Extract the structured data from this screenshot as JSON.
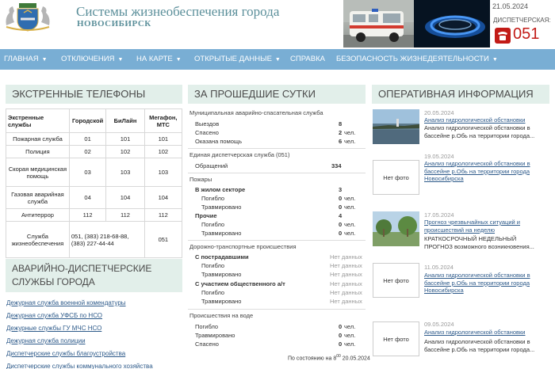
{
  "header": {
    "title": "Системы жизнеобеспечения города",
    "subtitle": "НОВОСИБИРСК",
    "date": "21.05.2024",
    "dispatch_label": "ДИСПЕТЧЕРСКАЯ:",
    "dispatch_number": "051"
  },
  "nav": {
    "items": [
      {
        "label": "ГЛАВНАЯ",
        "dropdown": true
      },
      {
        "label": "ОТКЛЮЧЕНИЯ",
        "dropdown": true
      },
      {
        "label": "НА КАРТЕ",
        "dropdown": true
      },
      {
        "label": "ОТКРЫТЫЕ ДАННЫЕ",
        "dropdown": true
      },
      {
        "label": "СПРАВКА",
        "dropdown": false
      },
      {
        "label": "БЕЗОПАСНОСТЬ ЖИЗНЕДЕЯТЕЛЬНОСТИ",
        "dropdown": true
      }
    ]
  },
  "phones": {
    "heading": "ЭКСТРЕННЫЕ ТЕЛЕФОНЫ",
    "columns": [
      "Экстренные службы",
      "Городской",
      "БиЛайн",
      "Мегафон, МТС"
    ],
    "rows": [
      {
        "service": "Пожарная служба",
        "city": "01",
        "beeline": "101",
        "megafon": "101"
      },
      {
        "service": "Полиция",
        "city": "02",
        "beeline": "102",
        "megafon": "102"
      },
      {
        "service": "Скорая медицинская помощь",
        "city": "03",
        "beeline": "103",
        "megafon": "103"
      },
      {
        "service": "Газовая аварийная служба",
        "city": "04",
        "beeline": "104",
        "megafon": "104"
      },
      {
        "service": "Антитеррор",
        "city": "112",
        "beeline": "112",
        "megafon": "112"
      },
      {
        "service": "Служба жизнеобеспечения",
        "city": "051, (383) 218-68-88, (383) 227-44-44",
        "beeline": "",
        "megafon": "051"
      }
    ]
  },
  "emergency_services": {
    "heading": "АВАРИЙНО-ДИСПЕТЧЕРСКИЕ СЛУЖБЫ ГОРОДА",
    "links": [
      "Дежурная служба военной комендатуры",
      "Дежурная служба УФСБ по НСО",
      "Дежурные службы ГУ МЧС НСО",
      "Дежурная служба полиции",
      "Диспетчерские службы благоустройства",
      "Диспетчерские службы коммунального хозяйства"
    ]
  },
  "day": {
    "heading": "ЗА ПРОШЕДШИЕ СУТКИ",
    "rescue": {
      "title": "Муниципальная аварийно-спасательная служба",
      "rows": [
        {
          "label": "Выездов",
          "value": "8",
          "unit": ""
        },
        {
          "label": "Спасено",
          "value": "2",
          "unit": "чел."
        },
        {
          "label": "Оказана помощь",
          "value": "6",
          "unit": "чел."
        }
      ]
    },
    "dispatch": {
      "title": "Единая диспетчерская служба (051)",
      "label": "Обращений",
      "value": "334"
    },
    "fires": {
      "title": "Пожары",
      "rows": [
        {
          "label": "В жилом секторе",
          "value": "3",
          "unit": "",
          "bold": true
        },
        {
          "label": "Погибло",
          "value": "0",
          "unit": "чел."
        },
        {
          "label": "Травмировано",
          "value": "0",
          "unit": "чел."
        },
        {
          "label": "Прочие",
          "value": "4",
          "unit": "",
          "bold": true
        },
        {
          "label": "Погибло",
          "value": "0",
          "unit": "чел."
        },
        {
          "label": "Травмировано",
          "value": "0",
          "unit": "чел."
        }
      ]
    },
    "road": {
      "title": "Дорожно-транспортные происшествия",
      "rows": [
        {
          "label": "С пострадавшими",
          "value": "Нет данных",
          "bold": true
        },
        {
          "label": "Погибло",
          "value": "Нет данных"
        },
        {
          "label": "Травмировано",
          "value": "Нет данных"
        },
        {
          "label": "С участием общественного а/т",
          "value": "Нет данных",
          "bold": true
        },
        {
          "label": "Погибло",
          "value": "Нет данных"
        },
        {
          "label": "Травмировано",
          "value": "Нет данных"
        }
      ]
    },
    "water": {
      "title": "Происшествия на воде",
      "rows": [
        {
          "label": "Погибло",
          "value": "0",
          "unit": "чел."
        },
        {
          "label": "Травмировано",
          "value": "0",
          "unit": "чел."
        },
        {
          "label": "Спасено",
          "value": "0",
          "unit": "чел."
        }
      ]
    },
    "status_prefix": "По состоянию на 8",
    "status_sup": "00",
    "status_date": "20.05.2024"
  },
  "news": {
    "heading": "ОПЕРАТИВНАЯ ИНФОРМАЦИЯ",
    "no_photo": "Нет фото",
    "items": [
      {
        "date": "20.05.2024",
        "link": "Анализ гидрологической обстановки",
        "desc": "Анализ гидрологической обстановки в бассейне р.Обь на территории города...",
        "photo": "river"
      },
      {
        "date": "19.05.2024",
        "link": "Анализ гидрологической обстановки в бассейне р.Обь на территории города Новосибирска",
        "desc": "",
        "photo": "none"
      },
      {
        "date": "17.05.2024",
        "link": "Прогноз чрезвычайных ситуаций и происшествий на неделю",
        "desc": "КРАТКОСРОЧНЫЙ НЕДЕЛЬНЫЙ ПРОГНОЗ возможного возникновения...",
        "photo": "park"
      },
      {
        "date": "11.05.2024",
        "link": "Анализ гидрологической обстановки в бассейне р.Обь на территории города Новосибирска",
        "desc": "",
        "photo": "none"
      },
      {
        "date": "09.05.2024",
        "link": "Анализ гидрологической обстановки",
        "desc": "Анализ гидрологической обстановки в бассейне р.Обь на территории города...",
        "photo": "none"
      }
    ]
  }
}
